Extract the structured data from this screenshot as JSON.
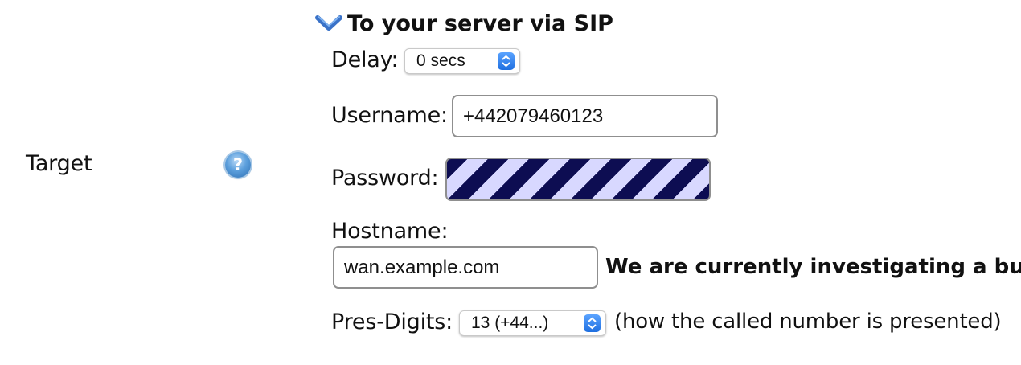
{
  "row": {
    "label": "Target",
    "help_icon": "question-icon"
  },
  "section": {
    "title": "To your server via SIP",
    "toggle_icon": "chevron-down-icon"
  },
  "fields": {
    "delay_label": "Delay:",
    "delay_value": "0 secs",
    "username_label": "Username:",
    "username_value": "+442079460123",
    "password_label": "Password:",
    "hostname_label": "Hostname:",
    "hostname_value": "wan.example.com",
    "hostname_notice": "We are currently investigating a bug w",
    "presdigits_label": "Pres-Digits:",
    "presdigits_value": "13 (+44...)",
    "presdigits_note": "(how the called number is presented)"
  },
  "colors": {
    "accent": "#2f7be6",
    "password_stripe_dark": "#0d0d52",
    "password_stripe_light": "#d8d8ff"
  }
}
